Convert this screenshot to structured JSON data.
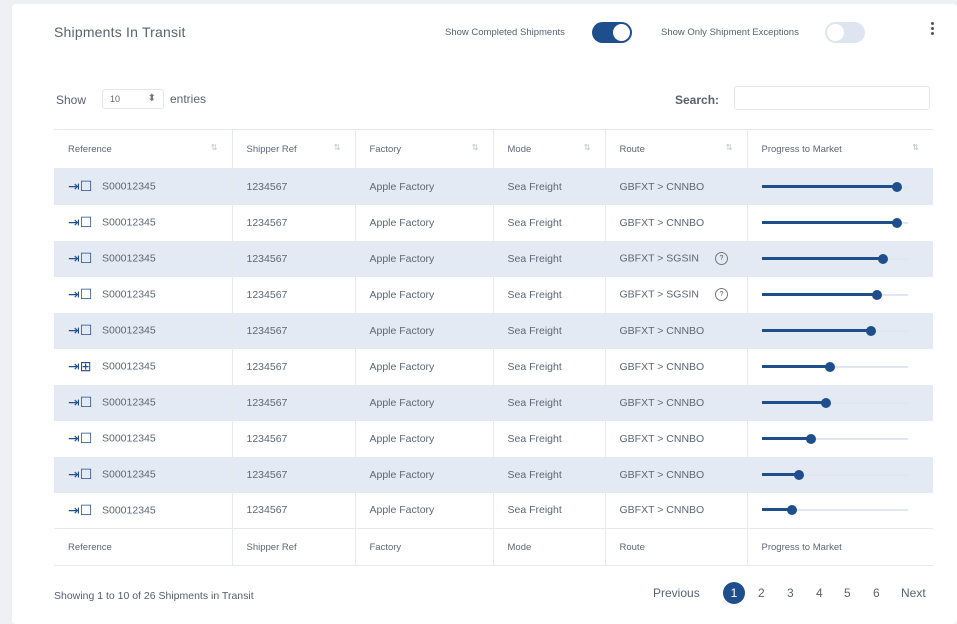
{
  "header": {
    "title": "Shipments In Transit",
    "toggle_completed_label": "Show Completed Shipments",
    "toggle_completed_on": true,
    "toggle_exceptions_label": "Show Only Shipment Exceptions",
    "toggle_exceptions_on": false,
    "menu_icon": "kebab-menu-icon"
  },
  "controls": {
    "show_label": "Show",
    "entries_value": "10",
    "entries_label": "entries",
    "search_label": "Search:",
    "search_value": ""
  },
  "table": {
    "columns": [
      "Reference",
      "Shipper Ref",
      "Factory",
      "Mode",
      "Route",
      "Progress to Market"
    ],
    "footer_columns": [
      "Reference",
      "Shipper Ref",
      "Factory",
      "Mode",
      "Route",
      "Progress to Market"
    ],
    "rows": [
      {
        "reference": "S00012345",
        "shipper_ref": "1234567",
        "factory": "Apple Factory",
        "mode": "Sea Freight",
        "route": "GBFXT > CNNBO",
        "progress": 0.93,
        "icon": "box-arrow-icon",
        "alert": false
      },
      {
        "reference": "S00012345",
        "shipper_ref": "1234567",
        "factory": "Apple Factory",
        "mode": "Sea Freight",
        "route": "GBFXT > CNNBO",
        "progress": 0.93,
        "icon": "box-arrow-icon",
        "alert": false
      },
      {
        "reference": "S00012345",
        "shipper_ref": "1234567",
        "factory": "Apple Factory",
        "mode": "Sea Freight",
        "route": "GBFXT > SGSIN",
        "progress": 0.83,
        "icon": "box-arrow-icon",
        "alert": true
      },
      {
        "reference": "S00012345",
        "shipper_ref": "1234567",
        "factory": "Apple Factory",
        "mode": "Sea Freight",
        "route": "GBFXT > SGSIN",
        "progress": 0.79,
        "icon": "box-arrow-icon",
        "alert": true
      },
      {
        "reference": "S00012345",
        "shipper_ref": "1234567",
        "factory": "Apple Factory",
        "mode": "Sea Freight",
        "route": "GBFXT > CNNBO",
        "progress": 0.75,
        "icon": "box-arrow-icon",
        "alert": false
      },
      {
        "reference": "S00012345",
        "shipper_ref": "1234567",
        "factory": "Apple Factory",
        "mode": "Sea Freight",
        "route": "GBFXT > CNNBO",
        "progress": 0.47,
        "icon": "grid-arrow-icon",
        "alert": false
      },
      {
        "reference": "S00012345",
        "shipper_ref": "1234567",
        "factory": "Apple Factory",
        "mode": "Sea Freight",
        "route": "GBFXT > CNNBO",
        "progress": 0.44,
        "icon": "box-arrow-icon",
        "alert": false
      },
      {
        "reference": "S00012345",
        "shipper_ref": "1234567",
        "factory": "Apple Factory",
        "mode": "Sea Freight",
        "route": "GBFXT > CNNBO",
        "progress": 0.34,
        "icon": "box-arrow-icon",
        "alert": false
      },
      {
        "reference": "S00012345",
        "shipper_ref": "1234567",
        "factory": "Apple Factory",
        "mode": "Sea Freight",
        "route": "GBFXT > CNNBO",
        "progress": 0.26,
        "icon": "box-arrow-icon",
        "alert": false
      },
      {
        "reference": "S00012345",
        "shipper_ref": "1234567",
        "factory": "Apple Factory",
        "mode": "Sea Freight",
        "route": "GBFXT > CNNBO",
        "progress": 0.21,
        "icon": "box-arrow-icon",
        "alert": false
      }
    ]
  },
  "footer": {
    "info": "Showing 1 to 10 of 26 Shipments in Transit",
    "previous": "Previous",
    "pages": [
      "1",
      "2",
      "3",
      "4",
      "5",
      "6"
    ],
    "active_page": "1",
    "next": "Next"
  },
  "colors": {
    "accent": "#1f4e8c",
    "stripe": "#e4eaf4"
  }
}
